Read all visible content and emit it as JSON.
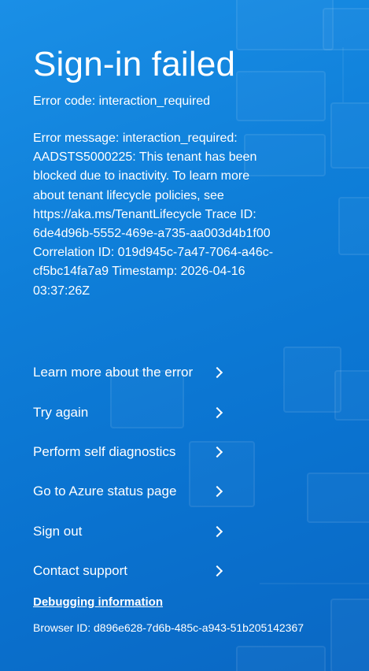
{
  "page": {
    "title": "Sign-in failed",
    "error_code": "Error code: interaction_required",
    "error_message": "Error message: interaction_required: AADSTS5000225: This tenant has been blocked due to inactivity. To learn more about tenant lifecycle policies, see https://aka.ms/TenantLifecycle Trace ID: 6de4d96b-5552-469e-a735-aa003d4b1f00 Correlation ID: 019d945c-7a47-7064-a46c-cf5bc14fa7a9 Timestamp: 2026-04-16 03:37:26Z"
  },
  "actions": [
    {
      "label": "Learn more about the error",
      "icon": "chevron-right-icon"
    },
    {
      "label": "Try again",
      "icon": "chevron-right-icon"
    },
    {
      "label": "Perform self diagnostics",
      "icon": "chevron-right-icon"
    },
    {
      "label": "Go to Azure status page",
      "icon": "chevron-right-icon"
    },
    {
      "label": "Sign out",
      "icon": "chevron-right-icon"
    },
    {
      "label": "Contact support",
      "icon": "chevron-right-icon"
    }
  ],
  "debug": {
    "link_label": "Debugging information",
    "browser_id": "Browser ID: d896e628-7d6b-485c-a943-51b205142367"
  },
  "colors": {
    "background": "#0f7fd9",
    "text": "#ffffff"
  }
}
